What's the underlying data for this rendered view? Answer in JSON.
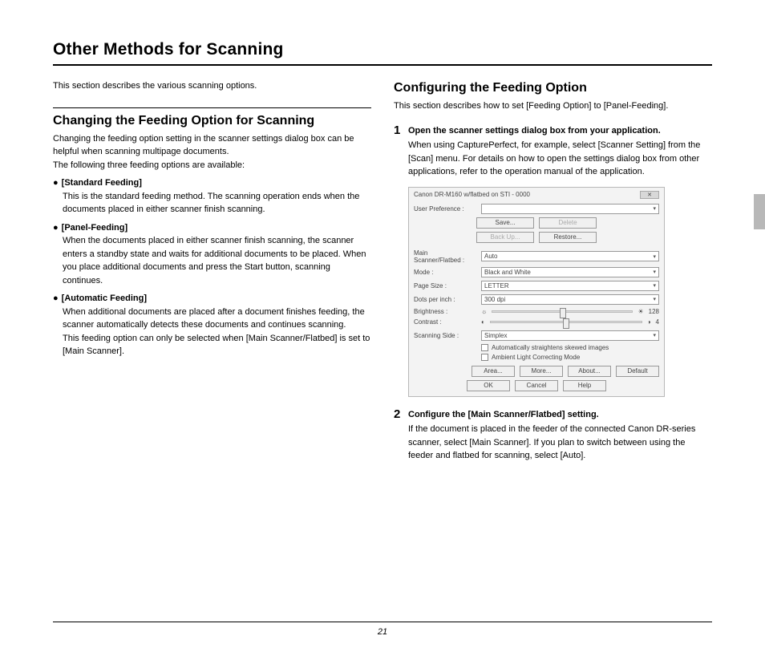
{
  "pageTitle": "Other Methods for Scanning",
  "intro": "This section describes the various scanning options.",
  "left": {
    "heading": "Changing the Feeding Option for Scanning",
    "lead1": "Changing the feeding option setting in the scanner settings dialog box can be helpful when scanning multipage documents.",
    "lead2": "The following three feeding options are available:",
    "bullets": [
      {
        "title": "[Standard Feeding]",
        "body": "This is the standard feeding method. The scanning operation ends when the documents placed in either scanner finish scanning."
      },
      {
        "title": "[Panel-Feeding]",
        "body": "When the documents placed in either scanner finish scanning, the scanner enters a standby state and waits for additional documents to be placed. When you place additional documents and press the Start button, scanning continues."
      },
      {
        "title": "[Automatic Feeding]",
        "body": "When additional documents are placed after a document finishes feeding, the scanner automatically detects these documents and continues scanning.",
        "body2": "This feeding option can only be selected when [Main Scanner/Flatbed] is set to [Main Scanner]."
      }
    ]
  },
  "right": {
    "heading": "Configuring the Feeding Option",
    "lead": "This section describes how to set [Feeding Option] to [Panel-Feeding].",
    "steps": [
      {
        "num": "1",
        "title": "Open the scanner settings dialog box from your application.",
        "body": "When using CapturePerfect, for example, select [Scanner Setting] from the [Scan] menu. For details on how to open the settings dialog box from other applications, refer to the operation manual of the application."
      },
      {
        "num": "2",
        "title": "Configure the [Main Scanner/Flatbed] setting.",
        "body": "If the document is placed in the feeder of the connected Canon DR-series scanner, select [Main Scanner]. If you plan to switch between using the feeder and flatbed for scanning, select [Auto]."
      }
    ],
    "dialog": {
      "title": "Canon DR-M160 w/flatbed on STI - 0000",
      "userPref": "User Preference :",
      "saveBtn": "Save...",
      "deleteBtn": "Delete",
      "backupBtn": "Back Up...",
      "restoreBtn": "Restore...",
      "rows": [
        {
          "label": "Main Scanner/Flatbed :",
          "value": "Auto"
        },
        {
          "label": "Mode :",
          "value": "Black and White"
        },
        {
          "label": "Page Size :",
          "value": "LETTER"
        },
        {
          "label": "Dots per inch :",
          "value": "300 dpi"
        }
      ],
      "brightness": "Brightness :",
      "brightVal": "128",
      "contrast": "Contrast :",
      "contrastVal": "4",
      "scanSide": {
        "label": "Scanning Side :",
        "value": "Simplex"
      },
      "cb1": "Automatically straightens skewed images",
      "cb2": "Ambient Light Correcting Mode",
      "buttons": {
        "area": "Area...",
        "more": "More...",
        "about": "About...",
        "default": "Default",
        "ok": "OK",
        "cancel": "Cancel",
        "help": "Help"
      }
    }
  },
  "pageNumber": "21"
}
